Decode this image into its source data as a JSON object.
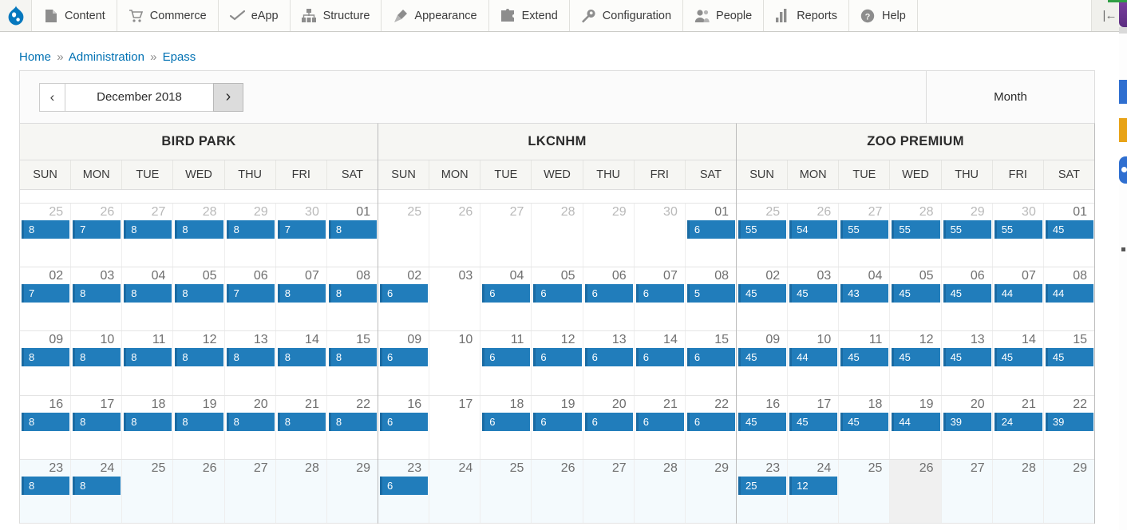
{
  "toolbar": {
    "logo_icon": "drupal-logo-icon",
    "collapse_icon": "collapse-toolbar-icon",
    "collapse_glyph": "|←",
    "items": [
      {
        "label": "Content",
        "icon": "content-page-icon"
      },
      {
        "label": "Commerce",
        "icon": "shopping-cart-icon"
      },
      {
        "label": "eApp",
        "icon": "checkmark-swoosh-icon"
      },
      {
        "label": "Structure",
        "icon": "structure-hierarchy-icon"
      },
      {
        "label": "Appearance",
        "icon": "paintbrush-icon"
      },
      {
        "label": "Extend",
        "icon": "puzzle-piece-icon"
      },
      {
        "label": "Configuration",
        "icon": "wrench-icon"
      },
      {
        "label": "People",
        "icon": "people-icon"
      },
      {
        "label": "Reports",
        "icon": "bar-chart-icon"
      },
      {
        "label": "Help",
        "icon": "question-mark-circle-icon"
      }
    ]
  },
  "breadcrumb": {
    "separator": "»",
    "items": [
      "Home",
      "Administration",
      "Epass"
    ]
  },
  "calendar_toolbar": {
    "prev_label": "‹",
    "prev_icon": "chevron-left-icon",
    "title": "December 2018",
    "next_label": "›",
    "next_icon": "chevron-right-icon",
    "month_view_label": "Month"
  },
  "colors": {
    "event_fill": "#217dbb",
    "event_border": "#1a6ba3",
    "link": "#0071b3",
    "header_bg": "#f6f6f3",
    "today_bg": "#f0f0f0",
    "last_week_bg": "#f4fafd"
  },
  "calendars": [
    {
      "title": "BIRD PARK",
      "day_names": [
        "SUN",
        "MON",
        "TUE",
        "WED",
        "THU",
        "FRI",
        "SAT"
      ],
      "weeks": [
        [
          {
            "date": "25",
            "current_month": false,
            "event": "8"
          },
          {
            "date": "26",
            "current_month": false,
            "event": "7"
          },
          {
            "date": "27",
            "current_month": false,
            "event": "8"
          },
          {
            "date": "28",
            "current_month": false,
            "event": "8"
          },
          {
            "date": "29",
            "current_month": false,
            "event": "8"
          },
          {
            "date": "30",
            "current_month": false,
            "event": "7"
          },
          {
            "date": "01",
            "current_month": true,
            "event": "8"
          }
        ],
        [
          {
            "date": "02",
            "current_month": true,
            "event": "7"
          },
          {
            "date": "03",
            "current_month": true,
            "event": "8"
          },
          {
            "date": "04",
            "current_month": true,
            "event": "8"
          },
          {
            "date": "05",
            "current_month": true,
            "event": "8"
          },
          {
            "date": "06",
            "current_month": true,
            "event": "7"
          },
          {
            "date": "07",
            "current_month": true,
            "event": "8"
          },
          {
            "date": "08",
            "current_month": true,
            "event": "8"
          }
        ],
        [
          {
            "date": "09",
            "current_month": true,
            "event": "8"
          },
          {
            "date": "10",
            "current_month": true,
            "event": "8"
          },
          {
            "date": "11",
            "current_month": true,
            "event": "8"
          },
          {
            "date": "12",
            "current_month": true,
            "event": "8"
          },
          {
            "date": "13",
            "current_month": true,
            "event": "8"
          },
          {
            "date": "14",
            "current_month": true,
            "event": "8"
          },
          {
            "date": "15",
            "current_month": true,
            "event": "8"
          }
        ],
        [
          {
            "date": "16",
            "current_month": true,
            "event": "8"
          },
          {
            "date": "17",
            "current_month": true,
            "event": "8"
          },
          {
            "date": "18",
            "current_month": true,
            "event": "8"
          },
          {
            "date": "19",
            "current_month": true,
            "event": "8"
          },
          {
            "date": "20",
            "current_month": true,
            "event": "8"
          },
          {
            "date": "21",
            "current_month": true,
            "event": "8"
          },
          {
            "date": "22",
            "current_month": true,
            "event": "8"
          }
        ],
        [
          {
            "date": "23",
            "current_month": true,
            "event": "8"
          },
          {
            "date": "24",
            "current_month": true,
            "event": "8"
          },
          {
            "date": "25",
            "current_month": true,
            "event": null
          },
          {
            "date": "26",
            "current_month": true,
            "event": null
          },
          {
            "date": "27",
            "current_month": true,
            "event": null
          },
          {
            "date": "28",
            "current_month": true,
            "event": null
          },
          {
            "date": "29",
            "current_month": true,
            "event": null
          }
        ]
      ]
    },
    {
      "title": "LKCNHM",
      "day_names": [
        "SUN",
        "MON",
        "TUE",
        "WED",
        "THU",
        "FRI",
        "SAT"
      ],
      "weeks": [
        [
          {
            "date": "25",
            "current_month": false,
            "event": null
          },
          {
            "date": "26",
            "current_month": false,
            "event": null
          },
          {
            "date": "27",
            "current_month": false,
            "event": null
          },
          {
            "date": "28",
            "current_month": false,
            "event": null
          },
          {
            "date": "29",
            "current_month": false,
            "event": null
          },
          {
            "date": "30",
            "current_month": false,
            "event": null
          },
          {
            "date": "01",
            "current_month": true,
            "event": "6"
          }
        ],
        [
          {
            "date": "02",
            "current_month": true,
            "event": "6"
          },
          {
            "date": "03",
            "current_month": true,
            "event": null
          },
          {
            "date": "04",
            "current_month": true,
            "event": "6"
          },
          {
            "date": "05",
            "current_month": true,
            "event": "6"
          },
          {
            "date": "06",
            "current_month": true,
            "event": "6"
          },
          {
            "date": "07",
            "current_month": true,
            "event": "6"
          },
          {
            "date": "08",
            "current_month": true,
            "event": "5"
          }
        ],
        [
          {
            "date": "09",
            "current_month": true,
            "event": "6"
          },
          {
            "date": "10",
            "current_month": true,
            "event": null
          },
          {
            "date": "11",
            "current_month": true,
            "event": "6"
          },
          {
            "date": "12",
            "current_month": true,
            "event": "6"
          },
          {
            "date": "13",
            "current_month": true,
            "event": "6"
          },
          {
            "date": "14",
            "current_month": true,
            "event": "6"
          },
          {
            "date": "15",
            "current_month": true,
            "event": "6"
          }
        ],
        [
          {
            "date": "16",
            "current_month": true,
            "event": "6"
          },
          {
            "date": "17",
            "current_month": true,
            "event": null
          },
          {
            "date": "18",
            "current_month": true,
            "event": "6"
          },
          {
            "date": "19",
            "current_month": true,
            "event": "6"
          },
          {
            "date": "20",
            "current_month": true,
            "event": "6"
          },
          {
            "date": "21",
            "current_month": true,
            "event": "6"
          },
          {
            "date": "22",
            "current_month": true,
            "event": "6"
          }
        ],
        [
          {
            "date": "23",
            "current_month": true,
            "event": "6"
          },
          {
            "date": "24",
            "current_month": true,
            "event": null
          },
          {
            "date": "25",
            "current_month": true,
            "event": null
          },
          {
            "date": "26",
            "current_month": true,
            "event": null
          },
          {
            "date": "27",
            "current_month": true,
            "event": null
          },
          {
            "date": "28",
            "current_month": true,
            "event": null
          },
          {
            "date": "29",
            "current_month": true,
            "event": null
          }
        ]
      ]
    },
    {
      "title": "ZOO PREMIUM",
      "day_names": [
        "SUN",
        "MON",
        "TUE",
        "WED",
        "THU",
        "FRI",
        "SAT"
      ],
      "weeks": [
        [
          {
            "date": "25",
            "current_month": false,
            "event": "55"
          },
          {
            "date": "26",
            "current_month": false,
            "event": "54"
          },
          {
            "date": "27",
            "current_month": false,
            "event": "55"
          },
          {
            "date": "28",
            "current_month": false,
            "event": "55"
          },
          {
            "date": "29",
            "current_month": false,
            "event": "55"
          },
          {
            "date": "30",
            "current_month": false,
            "event": "55"
          },
          {
            "date": "01",
            "current_month": true,
            "event": "45"
          }
        ],
        [
          {
            "date": "02",
            "current_month": true,
            "event": "45"
          },
          {
            "date": "03",
            "current_month": true,
            "event": "45"
          },
          {
            "date": "04",
            "current_month": true,
            "event": "43"
          },
          {
            "date": "05",
            "current_month": true,
            "event": "45"
          },
          {
            "date": "06",
            "current_month": true,
            "event": "45"
          },
          {
            "date": "07",
            "current_month": true,
            "event": "44"
          },
          {
            "date": "08",
            "current_month": true,
            "event": "44"
          }
        ],
        [
          {
            "date": "09",
            "current_month": true,
            "event": "45"
          },
          {
            "date": "10",
            "current_month": true,
            "event": "44"
          },
          {
            "date": "11",
            "current_month": true,
            "event": "45"
          },
          {
            "date": "12",
            "current_month": true,
            "event": "45"
          },
          {
            "date": "13",
            "current_month": true,
            "event": "45"
          },
          {
            "date": "14",
            "current_month": true,
            "event": "45"
          },
          {
            "date": "15",
            "current_month": true,
            "event": "45"
          }
        ],
        [
          {
            "date": "16",
            "current_month": true,
            "event": "45"
          },
          {
            "date": "17",
            "current_month": true,
            "event": "45"
          },
          {
            "date": "18",
            "current_month": true,
            "event": "45"
          },
          {
            "date": "19",
            "current_month": true,
            "event": "44"
          },
          {
            "date": "20",
            "current_month": true,
            "event": "39"
          },
          {
            "date": "21",
            "current_month": true,
            "event": "24"
          },
          {
            "date": "22",
            "current_month": true,
            "event": "39"
          }
        ],
        [
          {
            "date": "23",
            "current_month": true,
            "event": "25"
          },
          {
            "date": "24",
            "current_month": true,
            "event": "12"
          },
          {
            "date": "25",
            "current_month": true,
            "event": null
          },
          {
            "date": "26",
            "current_month": true,
            "event": null,
            "today": true
          },
          {
            "date": "27",
            "current_month": true,
            "event": null
          },
          {
            "date": "28",
            "current_month": true,
            "event": null
          },
          {
            "date": "29",
            "current_month": true,
            "event": null
          }
        ]
      ]
    }
  ]
}
